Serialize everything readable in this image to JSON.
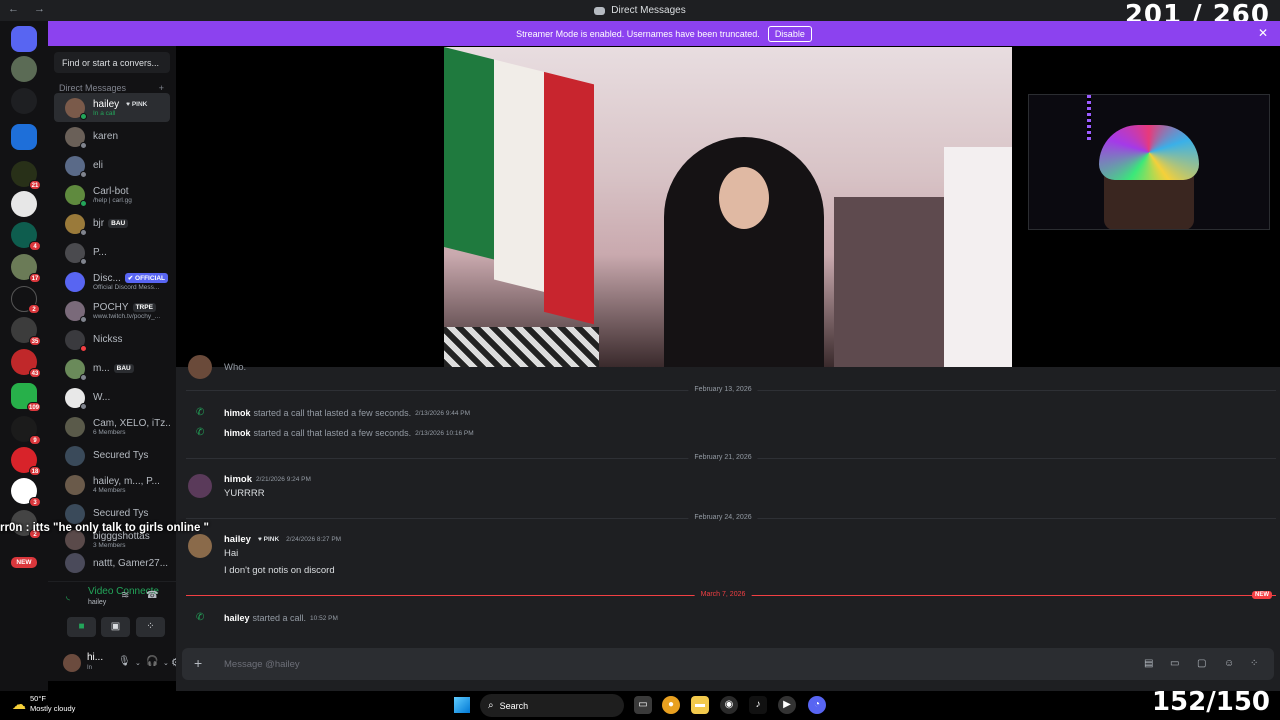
{
  "window": {
    "title": "Direct Messages",
    "nav": "← →"
  },
  "overlay": {
    "counter_top": "201 / 260",
    "counter_bottom": "152/150",
    "chat_user": "rr0n",
    "chat_text": ": itts \"he only talk to girls online \""
  },
  "banner": {
    "text": "Streamer Mode is enabled. Usernames have been truncated.",
    "button": "Disable",
    "close": "✕"
  },
  "guilds": {
    "badges": [
      "21",
      "4",
      "17",
      "2",
      "35",
      "43",
      "109",
      "9",
      "18",
      "3",
      "2"
    ],
    "new_label": "NEW",
    "colors": {
      "home": "#5865f2",
      "accent_red": "#da373c",
      "online": "#23a55a"
    }
  },
  "sidebar": {
    "search_placeholder": "Find or start a convers...",
    "section_title": "Direct Messages",
    "add_icon": "+",
    "items": [
      {
        "name": "hailey",
        "tag": "PINK",
        "sub": "In a call"
      },
      {
        "name": "karen"
      },
      {
        "name": "eli"
      },
      {
        "name": "Carl-bot",
        "sub": "/help | carl.gg"
      },
      {
        "name": "bjr",
        "tag": "BAU"
      },
      {
        "name": "P..."
      },
      {
        "name": "Disc...",
        "tag": "OFFICIAL",
        "sub": "Official Discord Mess..."
      },
      {
        "name": "POCHY",
        "tag": "TRPE",
        "sub": "www.twitch.tv/pochy_..."
      },
      {
        "name": "Nickss"
      },
      {
        "name": "m...",
        "tag": "BAU"
      },
      {
        "name": "W..."
      },
      {
        "name": "Cam, XELO, iTz...",
        "sub": "6 Members"
      },
      {
        "name": "Secured Tys"
      },
      {
        "name": "hailey, m..., P...",
        "sub": "4 Members"
      },
      {
        "name": "Secured Tys"
      },
      {
        "name": "bigggshottas",
        "sub": "3 Members"
      },
      {
        "name": "nattt, Gamer27..."
      }
    ]
  },
  "voice": {
    "title": "Video Connecte",
    "sub": "hailey"
  },
  "user": {
    "name": "hi...",
    "status": "In"
  },
  "chat": {
    "partial_top": "Who.",
    "dates": [
      "February 13, 2026",
      "February 21, 2026",
      "February 24, 2026",
      "March 7, 2026"
    ],
    "new_label": "NEW",
    "calls": [
      {
        "user": "himok",
        "text": "started a call that lasted a few seconds.",
        "time": "2/13/2026 9:44 PM"
      },
      {
        "user": "himok",
        "text": "started a call that lasted a few seconds.",
        "time": "2/13/2026 10:16 PM"
      }
    ],
    "msg1": {
      "user": "himok",
      "time": "2/21/2026 9:24 PM",
      "lines": [
        "YURRRR"
      ]
    },
    "msg2": {
      "user": "hailey",
      "tag": "PINK",
      "time": "2/24/2026 8:27 PM",
      "lines": [
        "Hai",
        "I don't got notis on discord"
      ]
    },
    "last_call": {
      "user": "hailey",
      "text": "started a call.",
      "time": "10:52 PM"
    },
    "composer_placeholder": "Message @hailey"
  },
  "taskbar": {
    "temp": "50°F",
    "weather": "Mostly cloudy",
    "search": "Search"
  }
}
